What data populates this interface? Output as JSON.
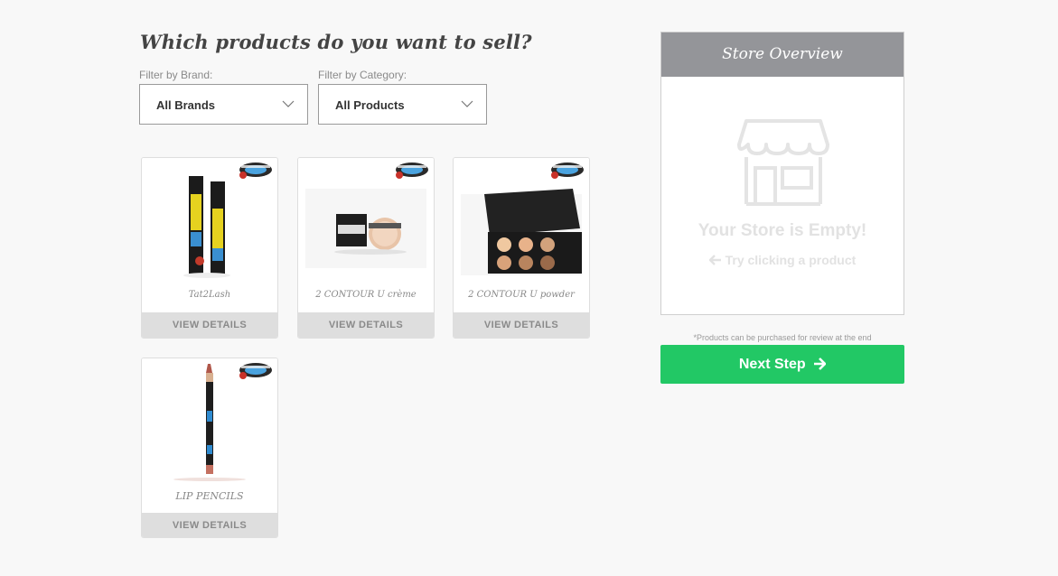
{
  "heading": "Which products do you want to sell?",
  "filters": {
    "brand": {
      "label": "Filter by Brand:",
      "value": "All Brands"
    },
    "category": {
      "label": "Filter by Category:",
      "value": "All Products"
    }
  },
  "products": [
    {
      "name": "Tat2Lash",
      "button": "VIEW DETAILS",
      "image_icon": "mascara-tubes"
    },
    {
      "name": "2 CONTOUR U crème",
      "button": "VIEW DETAILS",
      "image_icon": "cream-jar"
    },
    {
      "name": "2 CONTOUR U powder",
      "button": "VIEW DETAILS",
      "image_icon": "powder-palette"
    },
    {
      "name": "LIP PENCILS",
      "button": "VIEW DETAILS",
      "image_icon": "lip-pencil"
    }
  ],
  "store": {
    "title": "Store Overview",
    "empty_title": "Your Store is Empty!",
    "empty_hint": "Try clicking a product",
    "icon": "store-icon",
    "hint_icon": "arrow-left-icon"
  },
  "footer_note": "*Products can be purchased for review at the end",
  "next_button": {
    "label": "Next Step",
    "icon": "arrow-right-icon"
  },
  "colors": {
    "background": "#f8f8f8",
    "accent_green": "#22c865",
    "panel_header": "#949599",
    "card_button": "#dedede"
  }
}
